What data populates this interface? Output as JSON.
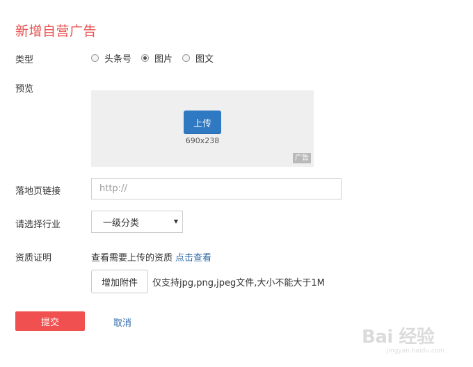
{
  "page": {
    "title": "新增自营广告"
  },
  "form": {
    "type": {
      "label": "类型",
      "options": [
        {
          "label": "头条号",
          "selected": false
        },
        {
          "label": "图片",
          "selected": true
        },
        {
          "label": "图文",
          "selected": false
        }
      ]
    },
    "preview": {
      "label": "预览",
      "upload_label": "上传",
      "size_text": "690x238",
      "badge": "广告"
    },
    "landing": {
      "label": "落地页链接",
      "placeholder": "http://",
      "value": ""
    },
    "industry": {
      "label": "请选择行业",
      "selected": "一级分类"
    },
    "qualification": {
      "label": "资质证明",
      "text": "查看需要上传的资质",
      "link": "点击查看",
      "attach_label": "增加附件",
      "hint": "仅支持jpg,png,jpeg文件,大小不能大于1M"
    }
  },
  "actions": {
    "submit_label": "提交",
    "cancel_label": "取消"
  },
  "watermark": {
    "text": "Bai 经验",
    "sub": "jingyan.baidu.com"
  },
  "colors": {
    "accent": "#e8504f",
    "submit": "#f0504f",
    "upload": "#2f78c2",
    "link": "#2f6aa8",
    "preview_bg": "#efefef"
  }
}
